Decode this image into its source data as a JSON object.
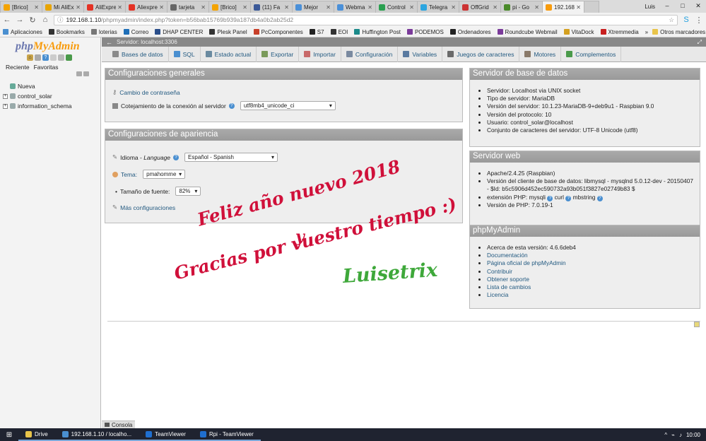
{
  "browser": {
    "tabs": [
      {
        "label": "[Brico]",
        "color": "#f4a300"
      },
      {
        "label": "Mi AliEx",
        "color": "#e8a400"
      },
      {
        "label": "AliExpre",
        "color": "#e43225"
      },
      {
        "label": "Aliexpre",
        "color": "#e43225"
      },
      {
        "label": "tarjeta",
        "color": "#666666"
      },
      {
        "label": "[Brico]",
        "color": "#f4a300"
      },
      {
        "label": "(11) Fa",
        "color": "#3b5998"
      },
      {
        "label": "Mejor",
        "color": "#4a90d9"
      },
      {
        "label": "Webma",
        "color": "#4a90d9"
      },
      {
        "label": "Control",
        "color": "#2aa050"
      },
      {
        "label": "Telegra",
        "color": "#2ca5e0"
      },
      {
        "label": "OffGrid",
        "color": "#cc3333"
      },
      {
        "label": "pi - Go",
        "color": "#4a8a2a"
      },
      {
        "label": "192.168",
        "color": "#f89c0e"
      }
    ],
    "user": "Luis",
    "url_host": "192.168.1.10",
    "url_path": "/phpmyadmin/index.php?token=b56bab15769b939a187db4a0b2ab25d2",
    "bookmarks": [
      "Aplicaciones",
      "Bookmarks",
      "loterias",
      "Correo",
      "DHAP CENTER",
      "Plesk Panel",
      "PcComponentes",
      "S7",
      "EOI",
      "Huffington Post",
      "PODEMOS",
      "Ordenadores",
      "Roundcube Webmail",
      "VitaDock",
      "Xtremmedia"
    ],
    "bookmarks_more": "»",
    "other_bookmarks": "Otros marcadores"
  },
  "sidebar": {
    "logo_php": "php",
    "logo_myadmin": "MyAdmin",
    "tab_recent": "Reciente",
    "tab_favorites": "Favoritas",
    "tree": [
      "Nueva",
      "control_solar",
      "information_schema"
    ]
  },
  "server_bar": {
    "text": "Servidor: localhost:3306"
  },
  "menu": [
    "Bases de datos",
    "SQL",
    "Estado actual",
    "Exportar",
    "Importar",
    "Configuración",
    "Variables",
    "Juegos de caracteres",
    "Motores",
    "Complementos"
  ],
  "general": {
    "title": "Configuraciones generales",
    "change_password": "Cambio de contraseña",
    "collation_label": "Cotejamiento de la conexión al servidor",
    "collation_value": "utf8mb4_unicode_ci"
  },
  "appearance": {
    "title": "Configuraciones de apariencia",
    "language_label": "Idioma - ",
    "language_italic": "Language",
    "language_value": "Español - Spanish",
    "theme_label": "Tema:",
    "theme_value": "pmahomme",
    "font_label": "Tamaño de fuente:",
    "font_value": "82%",
    "more": "Más configuraciones"
  },
  "db_server": {
    "title": "Servidor de base de datos",
    "items": [
      "Servidor: Localhost via UNIX socket",
      "Tipo de servidor: MariaDB",
      "Versión del servidor: 10.1.23-MariaDB-9+deb9u1 - Raspbian 9.0",
      "Versión del protocolo: 10",
      "Usuario: control_solar@localhost",
      "Conjunto de caracteres del servidor: UTF-8 Unicode (utf8)"
    ]
  },
  "web_server": {
    "title": "Servidor web",
    "items": [
      "Apache/2.4.25 (Raspbian)",
      "Versión del cliente de base de datos: libmysql - mysqlnd 5.0.12-dev - 20150407 - $Id: b5c5906d452ec590732a93b051f3827e02749b83 $",
      "extensión PHP: mysqli",
      "curl",
      "mbstring",
      "Versión de PHP: 7.0.19-1"
    ]
  },
  "pma": {
    "title": "phpMyAdmin",
    "version": "Acerca de esta versión: 4.6.6deb4",
    "links": [
      "Documentación",
      "Página oficial de phpMyAdmin",
      "Contribuir",
      "Obtener soporte",
      "Lista de cambios",
      "Licencia"
    ]
  },
  "overlay": {
    "line1": "Feliz año nuevo 2018",
    "line2": "y",
    "line3": "Gracias por vuestro tiempo :)",
    "signature": "Luisetrix",
    "red": "#d0103a",
    "green": "#3ea83a"
  },
  "console_label": "Consola",
  "taskbar": {
    "items": [
      "Drive",
      "192.168.1.10 / localho...",
      "TeamViewer",
      "Rpi - TeamViewer"
    ],
    "time": "10:00"
  }
}
